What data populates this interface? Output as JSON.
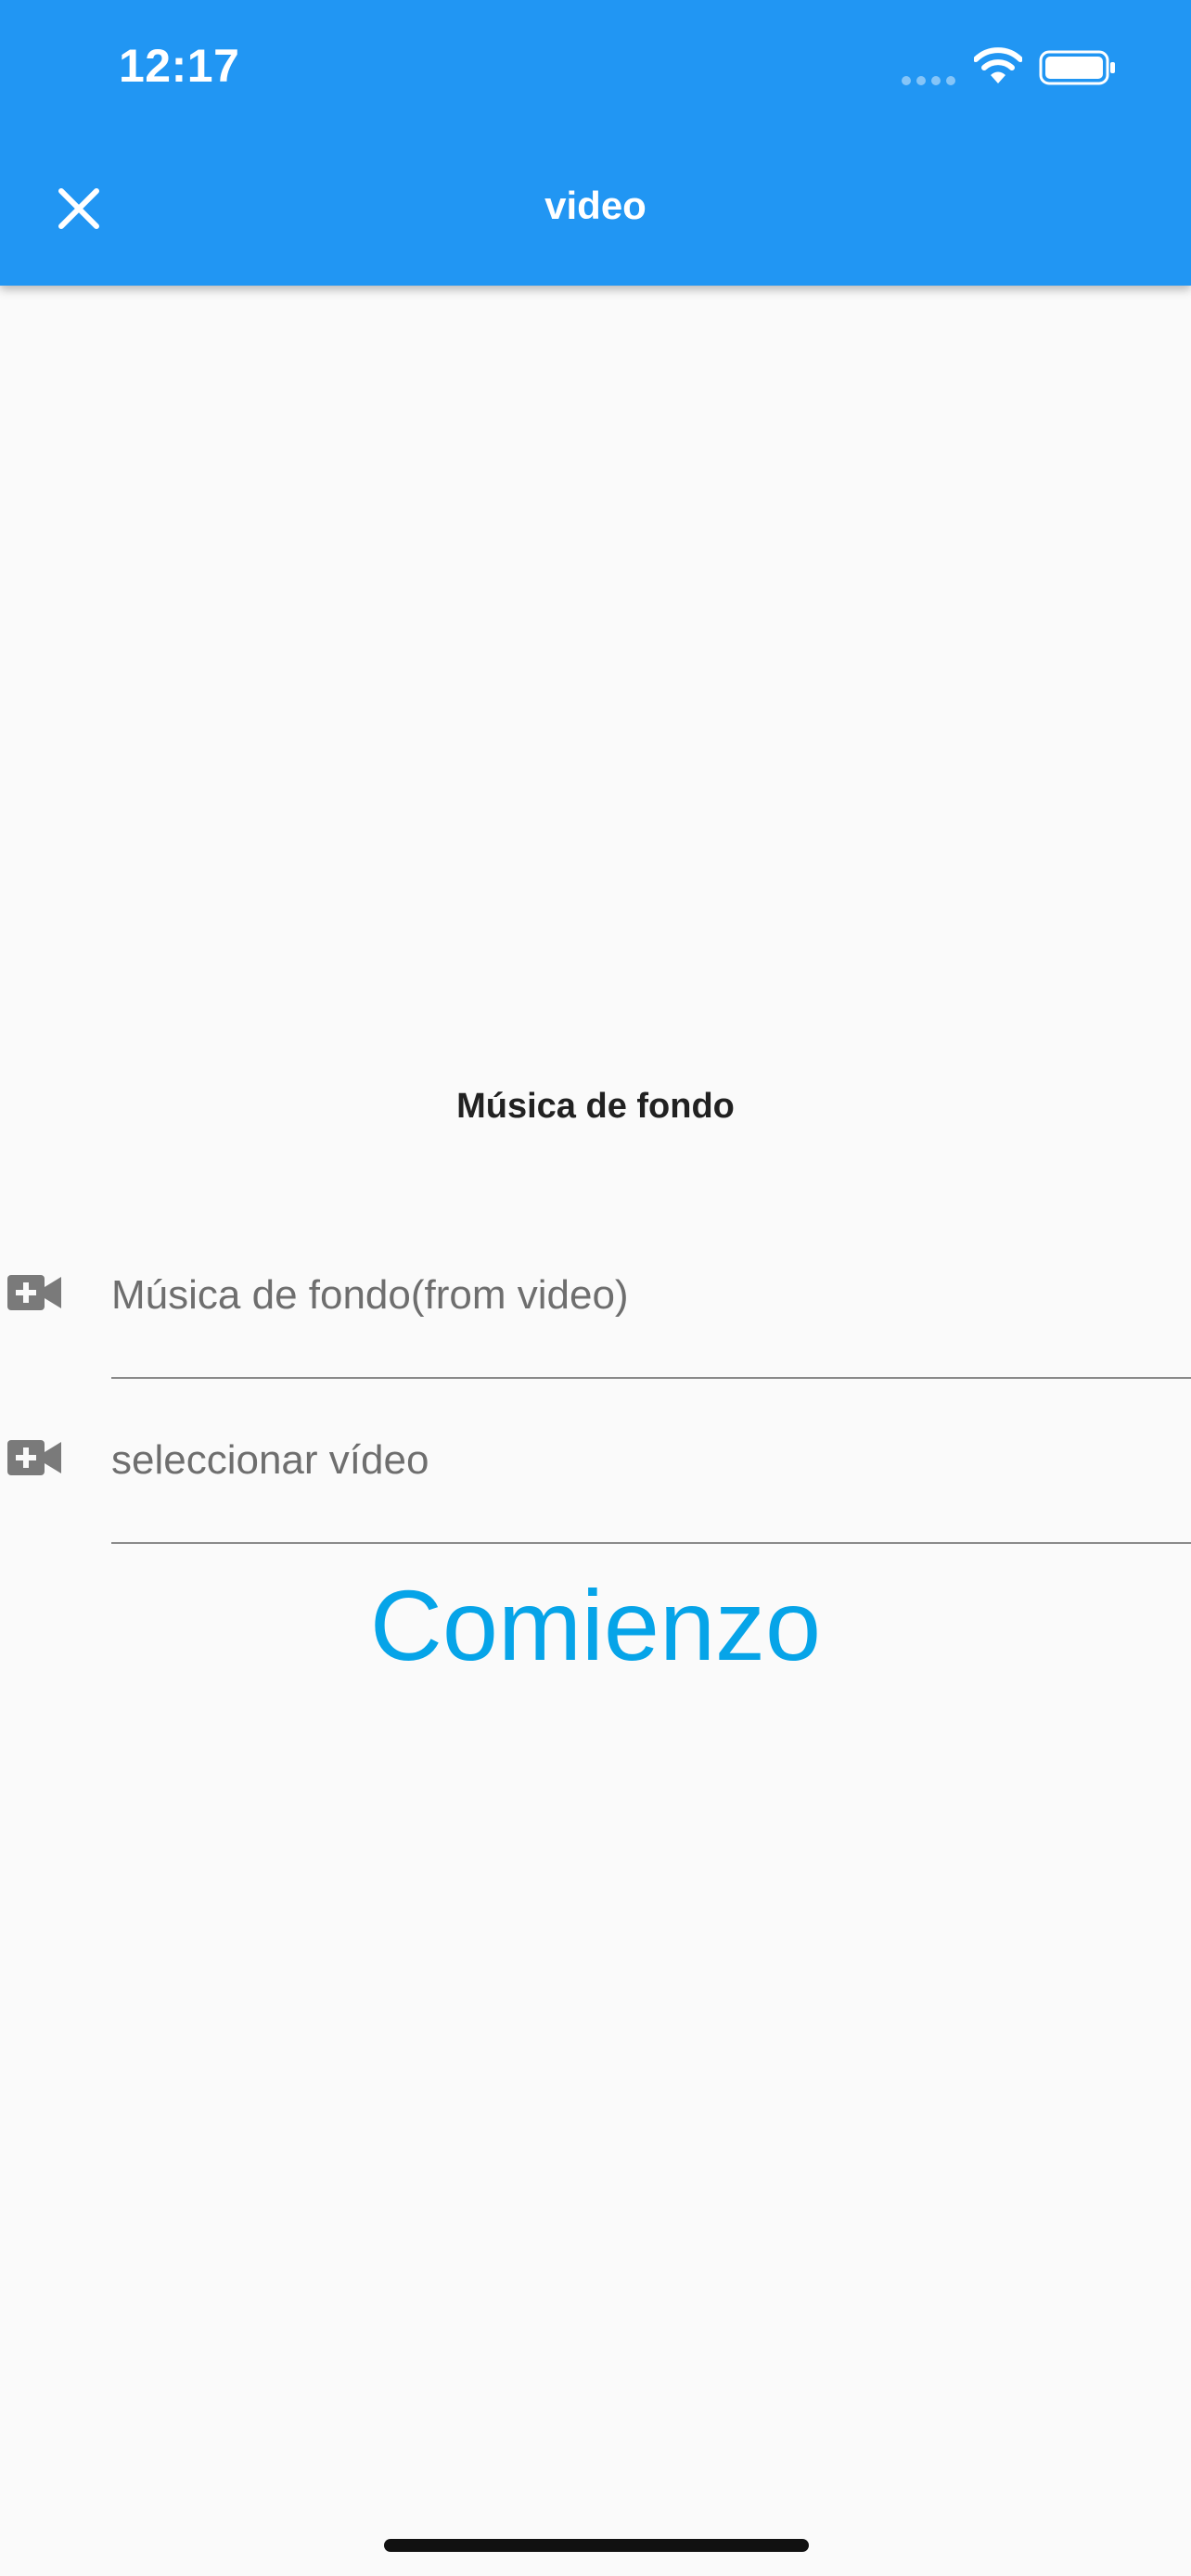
{
  "status_bar": {
    "time": "12:17",
    "wifi_icon": "wifi-icon",
    "battery_icon": "battery-icon"
  },
  "app_bar": {
    "title": "video",
    "close_icon": "close-icon",
    "background_color": "#2196f3"
  },
  "section": {
    "title": "Música de fondo"
  },
  "fields": [
    {
      "icon": "video-add-icon",
      "placeholder": "Música de fondo(from video)"
    },
    {
      "icon": "video-add-icon",
      "placeholder": "seleccionar vídeo"
    }
  ],
  "start_button": {
    "label": "Comienzo",
    "color": "#06a4e8"
  }
}
